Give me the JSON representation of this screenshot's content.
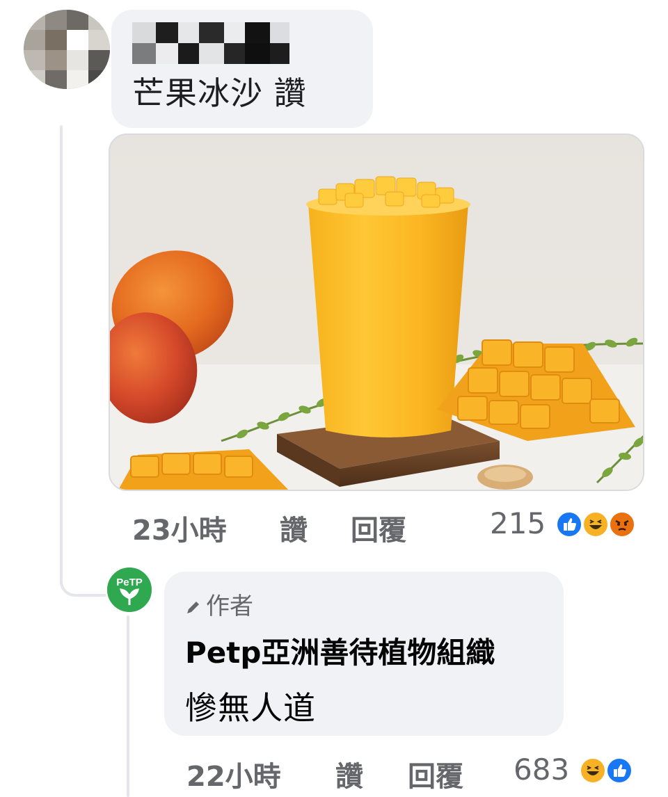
{
  "comment": {
    "text": "芒果冰沙 讚",
    "time": "23小時",
    "like_label": "讚",
    "reply_label": "回覆",
    "reaction_count": "215",
    "reactions": [
      "like-icon",
      "haha-icon",
      "angry-icon"
    ],
    "image": "mango-smoothie-photo"
  },
  "reply": {
    "author_badge": "作者",
    "author_name": "Petp亞洲善待植物組織",
    "text": "慘無人道",
    "time": "22小時",
    "like_label": "讚",
    "reply_label": "回覆",
    "reaction_count": "683",
    "reactions": [
      "haha-icon",
      "like-icon"
    ],
    "avatar_text": "PeTP"
  },
  "colors": {
    "bubble": "#f0f2f5",
    "meta_text": "#65676b",
    "like_blue": "#1877f2",
    "haha_yellow": "#f7b125",
    "angry_orange": "#e9710f",
    "petp_green": "#2fa84f"
  }
}
